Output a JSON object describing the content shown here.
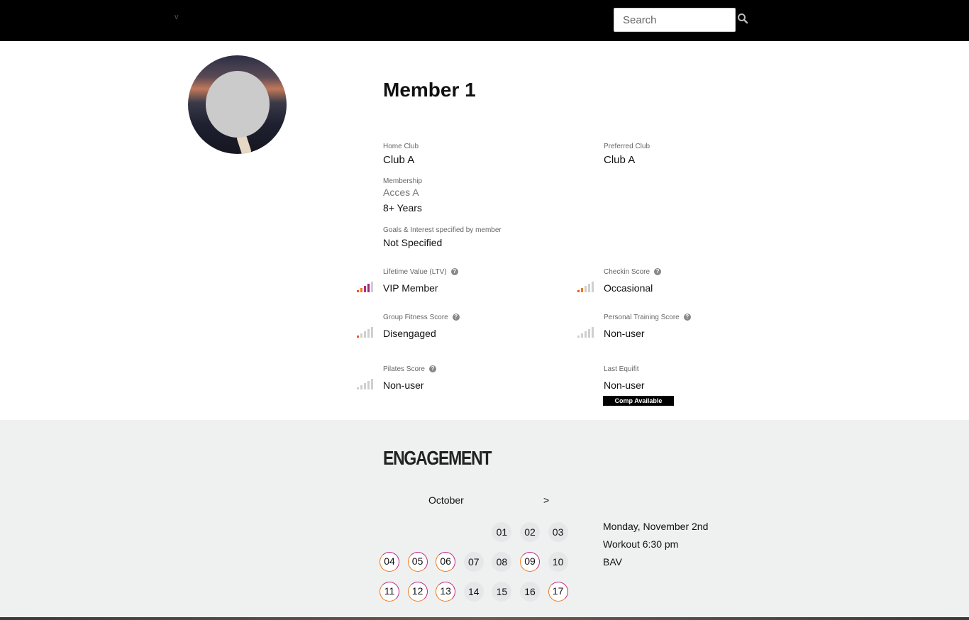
{
  "nav": {
    "menu_text": "v",
    "search_placeholder": "Search"
  },
  "member": {
    "name": "Member 1",
    "home_club": {
      "label": "Home Club",
      "value": "Club A"
    },
    "preferred_club": {
      "label": "Preferred Club",
      "value": "Club A"
    },
    "membership": {
      "label": "Membership",
      "value": "Acces A",
      "tenure": "8+ Years"
    },
    "goals": {
      "label": "Goals & Interest specified by member",
      "value": "Not Specified"
    }
  },
  "scores": {
    "ltv": {
      "label": "Lifetime Value (LTV)",
      "value": "VIP Member",
      "level": 4
    },
    "checkin": {
      "label": "Checkin Score",
      "value": "Occasional",
      "level": 2
    },
    "group_fitness": {
      "label": "Group Fitness Score",
      "value": "Disengaged",
      "level": 1
    },
    "personal_training": {
      "label": "Personal Training Score",
      "value": "Non-user",
      "level": 0
    },
    "pilates": {
      "label": "Pilates Score",
      "value": "Non-user",
      "level": 0
    },
    "last_equifit": {
      "label": "Last Equifit",
      "value": "Non-user",
      "badge": "Comp Available"
    }
  },
  "engagement": {
    "title": "ENGAGEMENT",
    "month": "October",
    "next": ">",
    "weeks": [
      [
        null,
        null,
        null,
        null,
        "01",
        "02",
        "03"
      ],
      [
        "04",
        "05",
        "06",
        "07",
        "08",
        "09",
        "10"
      ],
      [
        "11",
        "12",
        "13",
        "14",
        "15",
        "16",
        "17"
      ]
    ],
    "ringed_days": [
      "04",
      "05",
      "06",
      "09",
      "11",
      "12",
      "13",
      "17"
    ],
    "event": {
      "date": "Monday, November 2nd",
      "time": "Workout 6:30 pm",
      "location": "BAV"
    }
  },
  "colors": {
    "accent_orange": "#f07a1a",
    "accent_magenta": "#c0258a",
    "ltv_top": "#9b2a7a"
  }
}
